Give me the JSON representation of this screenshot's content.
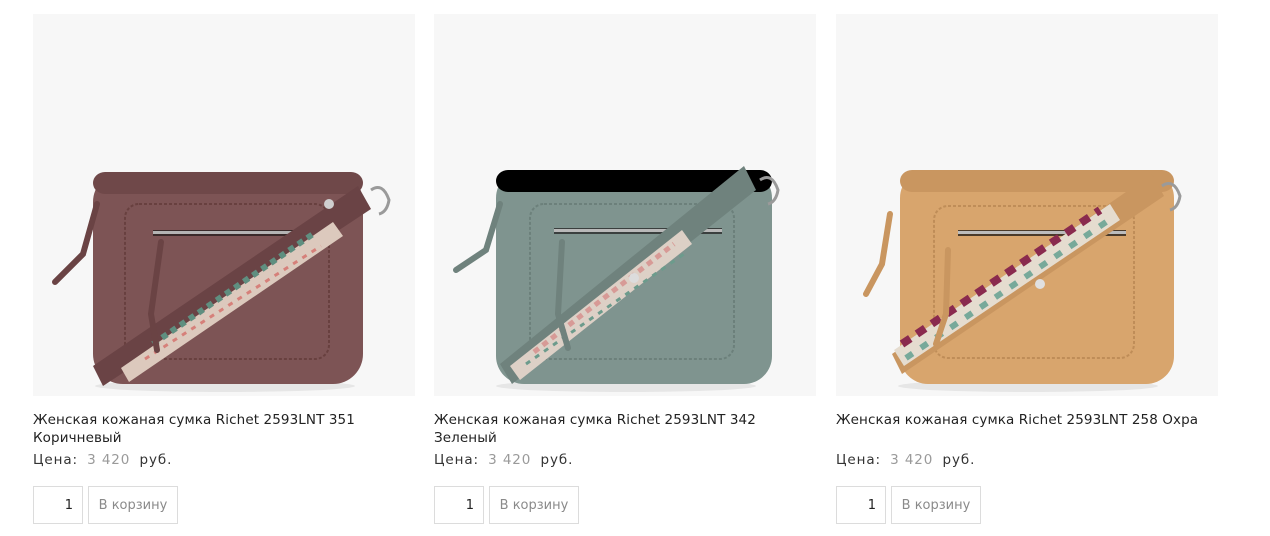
{
  "products": [
    {
      "title": "Женская кожаная сумка Richet 2593LNT 351 Коричневый",
      "price_label": "Цена:",
      "price": "3 420",
      "currency": "руб.",
      "qty": "1",
      "cart_label": "В корзину",
      "color": "#7d5455",
      "image_icon": "handbag-brown-image"
    },
    {
      "title": "Женская кожаная сумка Richet 2593LNT 342 Зеленый",
      "price_label": "Цена:",
      "price": "3 420",
      "currency": "руб.",
      "qty": "1",
      "cart_label": "В корзину",
      "color": "#7f948f",
      "image_icon": "handbag-green-image"
    },
    {
      "title": "Женская кожаная сумка Richet 2593LNT 258 Охра",
      "price_label": "Цена:",
      "price": "3 420",
      "currency": "руб.",
      "qty": "1",
      "cart_label": "В корзину",
      "color": "#d8a56d",
      "image_icon": "handbag-ochre-image"
    }
  ]
}
